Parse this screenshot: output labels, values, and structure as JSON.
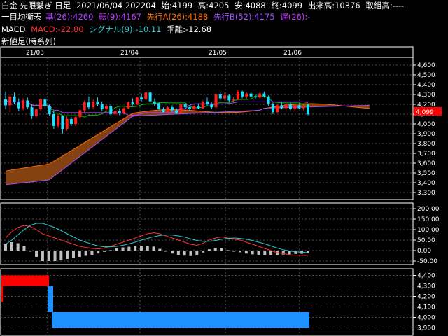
{
  "header": {
    "instrument": "白金 先限繋ぎ 日足",
    "date_time": "2021/06/04 202204",
    "open": "始:4199",
    "high": "高:4205",
    "low": "安:4088",
    "close": "終:4099",
    "volume": "出来高:10376",
    "turnover": "取組高:----"
  },
  "ichimoku": {
    "label": "一目均衡表",
    "kijun": "基(26):4260",
    "tenkan": "転(9):4167",
    "senkou_a": "先行A(26):4188",
    "senkou_b": "先行B(52):4175",
    "chikou": "遅(26):-"
  },
  "macd": {
    "label": "MACD",
    "macd": "MACD:-22.80",
    "signal": "シグナル(9):-10.11",
    "diff": "乖離:-12.68"
  },
  "newprice": {
    "label": "新値足(時系列)"
  },
  "colors": {
    "kijun": "#b040ff",
    "tenkan": "#00c000",
    "senkou_a": "#ff6a00",
    "senkou_b": "#a050ff",
    "cloud": "#8b4513",
    "up_candle": "#ff2020",
    "down_candle": "#20e0ff",
    "macd": "#ff3030",
    "signal": "#30c8d0",
    "hist": "#c0c0c0",
    "newprice_up": "#ff0000",
    "newprice_down": "#1e90ff",
    "price_tag": "#ff0000"
  },
  "price_axis": {
    "ticks": [
      "4,600",
      "4,500",
      "4,400",
      "4,300",
      "4,200",
      "4,100",
      "4,000",
      "3,900",
      "3,800",
      "3,700",
      "3,600",
      "3,500",
      "3,400",
      "3,300"
    ],
    "current_price": "4,099"
  },
  "macd_axis": {
    "ticks": [
      "200.00",
      "150.00",
      "100.00",
      "50.00",
      "0.00",
      "-50.00"
    ]
  },
  "newprice_axis": {
    "ticks": [
      "4,400",
      "4,300",
      "4,200",
      "4,100",
      "4,000",
      "3,900"
    ]
  },
  "x_axis": {
    "labels": [
      "21/03",
      "21/04",
      "21/05",
      "21/06"
    ]
  },
  "chart_data": [
    {
      "type": "candlestick",
      "ylim": [
        3250,
        4650
      ],
      "candles": [
        {
          "o": 4250,
          "h": 4330,
          "l": 4150,
          "c": 4190
        },
        {
          "o": 4190,
          "h": 4300,
          "l": 4120,
          "c": 4280
        },
        {
          "o": 4280,
          "h": 4320,
          "l": 4200,
          "c": 4220
        },
        {
          "o": 4220,
          "h": 4260,
          "l": 4130,
          "c": 4160
        },
        {
          "o": 4160,
          "h": 4260,
          "l": 4140,
          "c": 4240
        },
        {
          "o": 4240,
          "h": 4270,
          "l": 4150,
          "c": 4170
        },
        {
          "o": 4170,
          "h": 4200,
          "l": 4050,
          "c": 4080
        },
        {
          "o": 4080,
          "h": 4160,
          "l": 4070,
          "c": 4150
        },
        {
          "o": 4150,
          "h": 4260,
          "l": 4130,
          "c": 4250
        },
        {
          "o": 4250,
          "h": 4270,
          "l": 4160,
          "c": 4180
        },
        {
          "o": 4180,
          "h": 4200,
          "l": 4080,
          "c": 4100
        },
        {
          "o": 4100,
          "h": 4130,
          "l": 3950,
          "c": 3980
        },
        {
          "o": 3980,
          "h": 4100,
          "l": 3960,
          "c": 4080
        },
        {
          "o": 4080,
          "h": 4090,
          "l": 3900,
          "c": 3950
        },
        {
          "o": 3950,
          "h": 4080,
          "l": 3930,
          "c": 4050
        },
        {
          "o": 4050,
          "h": 4070,
          "l": 3980,
          "c": 4000
        },
        {
          "o": 4000,
          "h": 4080,
          "l": 3980,
          "c": 4070
        },
        {
          "o": 4070,
          "h": 4150,
          "l": 4050,
          "c": 4140
        },
        {
          "o": 4140,
          "h": 4240,
          "l": 4120,
          "c": 4220
        },
        {
          "o": 4220,
          "h": 4280,
          "l": 4150,
          "c": 4170
        },
        {
          "o": 4170,
          "h": 4250,
          "l": 4150,
          "c": 4230
        },
        {
          "o": 4230,
          "h": 4270,
          "l": 4180,
          "c": 4200
        },
        {
          "o": 4200,
          "h": 4230,
          "l": 4130,
          "c": 4150
        },
        {
          "o": 4150,
          "h": 4200,
          "l": 4120,
          "c": 4180
        },
        {
          "o": 4180,
          "h": 4200,
          "l": 4080,
          "c": 4100
        },
        {
          "o": 4100,
          "h": 4150,
          "l": 4080,
          "c": 4130
        },
        {
          "o": 4130,
          "h": 4160,
          "l": 4090,
          "c": 4110
        },
        {
          "o": 4110,
          "h": 4170,
          "l": 4100,
          "c": 4160
        },
        {
          "o": 4160,
          "h": 4230,
          "l": 4150,
          "c": 4220
        },
        {
          "o": 4220,
          "h": 4260,
          "l": 4190,
          "c": 4200
        },
        {
          "o": 4200,
          "h": 4280,
          "l": 4190,
          "c": 4270
        },
        {
          "o": 4270,
          "h": 4310,
          "l": 4230,
          "c": 4250
        },
        {
          "o": 4250,
          "h": 4330,
          "l": 4240,
          "c": 4320
        },
        {
          "o": 4320,
          "h": 4330,
          "l": 4220,
          "c": 4230
        },
        {
          "o": 4230,
          "h": 4260,
          "l": 4180,
          "c": 4210
        },
        {
          "o": 4210,
          "h": 4220,
          "l": 4140,
          "c": 4150
        },
        {
          "o": 4150,
          "h": 4170,
          "l": 4110,
          "c": 4120
        },
        {
          "o": 4120,
          "h": 4180,
          "l": 4100,
          "c": 4170
        },
        {
          "o": 4170,
          "h": 4190,
          "l": 4120,
          "c": 4140
        },
        {
          "o": 4140,
          "h": 4160,
          "l": 4100,
          "c": 4110
        },
        {
          "o": 4110,
          "h": 4210,
          "l": 4100,
          "c": 4200
        },
        {
          "o": 4200,
          "h": 4230,
          "l": 4150,
          "c": 4170
        },
        {
          "o": 4170,
          "h": 4190,
          "l": 4130,
          "c": 4150
        },
        {
          "o": 4150,
          "h": 4190,
          "l": 4120,
          "c": 4180
        },
        {
          "o": 4180,
          "h": 4210,
          "l": 4150,
          "c": 4160
        },
        {
          "o": 4160,
          "h": 4240,
          "l": 4150,
          "c": 4230
        },
        {
          "o": 4230,
          "h": 4270,
          "l": 4180,
          "c": 4200
        },
        {
          "o": 4200,
          "h": 4220,
          "l": 4150,
          "c": 4170
        },
        {
          "o": 4170,
          "h": 4310,
          "l": 4160,
          "c": 4300
        },
        {
          "o": 4300,
          "h": 4320,
          "l": 4240,
          "c": 4260
        },
        {
          "o": 4260,
          "h": 4320,
          "l": 4240,
          "c": 4290
        },
        {
          "o": 4290,
          "h": 4300,
          "l": 4220,
          "c": 4240
        },
        {
          "o": 4240,
          "h": 4270,
          "l": 4220,
          "c": 4250
        },
        {
          "o": 4250,
          "h": 4350,
          "l": 4240,
          "c": 4330
        },
        {
          "o": 4330,
          "h": 4340,
          "l": 4260,
          "c": 4280
        },
        {
          "o": 4280,
          "h": 4320,
          "l": 4260,
          "c": 4310
        },
        {
          "o": 4310,
          "h": 4330,
          "l": 4270,
          "c": 4280
        },
        {
          "o": 4280,
          "h": 4300,
          "l": 4250,
          "c": 4270
        },
        {
          "o": 4270,
          "h": 4320,
          "l": 4260,
          "c": 4310
        },
        {
          "o": 4310,
          "h": 4330,
          "l": 4270,
          "c": 4280
        },
        {
          "o": 4280,
          "h": 4290,
          "l": 4180,
          "c": 4200
        },
        {
          "o": 4200,
          "h": 4220,
          "l": 4100,
          "c": 4120
        },
        {
          "o": 4120,
          "h": 4200,
          "l": 4110,
          "c": 4190
        },
        {
          "o": 4190,
          "h": 4230,
          "l": 4150,
          "c": 4160
        },
        {
          "o": 4160,
          "h": 4210,
          "l": 4140,
          "c": 4200
        },
        {
          "o": 4200,
          "h": 4220,
          "l": 4140,
          "c": 4150
        },
        {
          "o": 4150,
          "h": 4200,
          "l": 4130,
          "c": 4190
        },
        {
          "o": 4190,
          "h": 4210,
          "l": 4150,
          "c": 4160
        },
        {
          "o": 4160,
          "h": 4190,
          "l": 4140,
          "c": 4180
        },
        {
          "o": 4199,
          "h": 4205,
          "l": 4088,
          "c": 4099
        }
      ]
    },
    {
      "type": "line",
      "series": [
        {
          "name": "MACD",
          "values": [
            60,
            90,
            110,
            120,
            115,
            100,
            80,
            70,
            60,
            50,
            40,
            30,
            20,
            15,
            10,
            8,
            12,
            20,
            30,
            40,
            50,
            60,
            70,
            80,
            85,
            80,
            70,
            60,
            50,
            40,
            30,
            25,
            35,
            50,
            60,
            65,
            60,
            55,
            50,
            40,
            30,
            20,
            10,
            0,
            -10,
            -15,
            -20,
            -22,
            -23,
            -23
          ]
        },
        {
          "name": "シグナル(9)",
          "values": [
            30,
            50,
            75,
            100,
            120,
            130,
            130,
            120,
            110,
            95,
            80,
            65,
            50,
            40,
            30,
            22,
            18,
            18,
            20,
            25,
            32,
            40,
            50,
            58,
            66,
            72,
            75,
            74,
            70,
            64,
            56,
            48,
            44,
            44,
            48,
            54,
            58,
            60,
            58,
            54,
            48,
            40,
            32,
            22,
            12,
            4,
            -2,
            -6,
            -8,
            -10
          ]
        }
      ],
      "histogram": [
        30,
        40,
        35,
        20,
        -5,
        -30,
        -50,
        -50,
        -50,
        -45,
        -40,
        -35,
        -30,
        -25,
        -20,
        -14,
        -6,
        2,
        10,
        15,
        18,
        20,
        20,
        22,
        19,
        8,
        -5,
        -14,
        -20,
        -24,
        -26,
        -23,
        -9,
        6,
        12,
        11,
        2,
        -5,
        -8,
        -14,
        -18,
        -20,
        -22,
        -22,
        -22,
        -19,
        -18,
        -16,
        -15,
        -13
      ],
      "ylim": [
        -60,
        220
      ]
    },
    {
      "type": "bar",
      "title": "新値足(時系列)",
      "blocks": [
        {
          "dir": "up",
          "from": 4200,
          "to": 4400
        },
        {
          "dir": "down",
          "from": 4300,
          "to": 4050
        },
        {
          "dir": "down",
          "from": 4050,
          "to": 3900
        }
      ],
      "ylim": [
        3850,
        4450
      ]
    }
  ]
}
